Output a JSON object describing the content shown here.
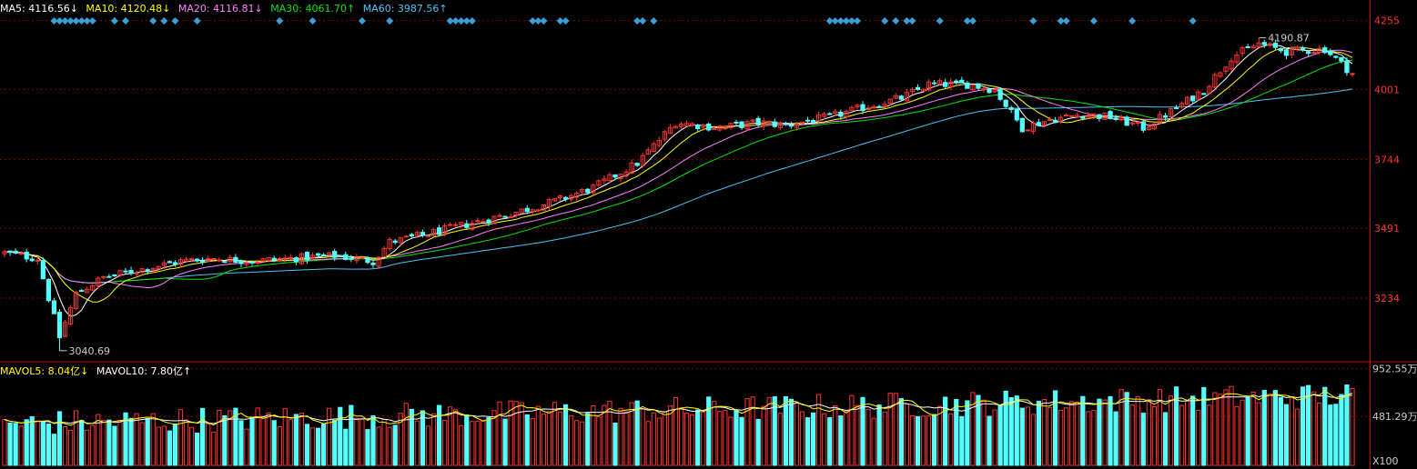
{
  "colors": {
    "up": "#ff3232",
    "down": "#54ffff",
    "grid": "#8b0000",
    "axis_text": "#ff3232",
    "ma5": "#ffffff",
    "ma10": "#ffff00",
    "ma20": "#ff80ff",
    "ma30": "#00e600",
    "ma60": "#4fc3f7",
    "marker": "#3aa0d9"
  },
  "legends": {
    "ma5": "MA5: 4116.56↓",
    "ma10": "MA10: 4120.48↓",
    "ma20": "MA20: 4116.81↓",
    "ma30": "MA30: 4061.70↑",
    "ma60": "MA60: 3987.56↑",
    "mavol5": "MAVOL5: 8.04亿↓",
    "mavol10": "MAVOL10: 7.80亿↑"
  },
  "chart_data": {
    "type": "candlestick",
    "price_axis": {
      "ylim": [
        3000,
        4330
      ],
      "ticks": [
        "4255",
        "4001",
        "3744",
        "3491",
        "3234"
      ],
      "tick_values": [
        4255,
        4001,
        3744,
        3491,
        3234
      ]
    },
    "volume_axis": {
      "ylim": [
        0,
        1000
      ],
      "ticks": [
        "952.55万",
        "481.29万"
      ],
      "tick_values": [
        952.55,
        481.29
      ],
      "unit": "X100"
    },
    "annotations": [
      {
        "text": "4190.87",
        "value": 4190.87,
        "bar": 228
      },
      {
        "text": "3040.69",
        "value": 3040.69,
        "bar": 10
      }
    ],
    "bar_count": 246,
    "anchors": [
      {
        "i": 0,
        "v": 3400
      },
      {
        "i": 6,
        "v": 3380
      },
      {
        "i": 10,
        "v": 3090
      },
      {
        "i": 13,
        "v": 3250
      },
      {
        "i": 18,
        "v": 3310
      },
      {
        "i": 25,
        "v": 3340
      },
      {
        "i": 32,
        "v": 3370
      },
      {
        "i": 38,
        "v": 3380
      },
      {
        "i": 45,
        "v": 3370
      },
      {
        "i": 52,
        "v": 3380
      },
      {
        "i": 60,
        "v": 3390
      },
      {
        "i": 67,
        "v": 3370
      },
      {
        "i": 70,
        "v": 3440
      },
      {
        "i": 77,
        "v": 3470
      },
      {
        "i": 85,
        "v": 3510
      },
      {
        "i": 93,
        "v": 3550
      },
      {
        "i": 100,
        "v": 3590
      },
      {
        "i": 107,
        "v": 3640
      },
      {
        "i": 115,
        "v": 3730
      },
      {
        "i": 122,
        "v": 3880
      },
      {
        "i": 130,
        "v": 3860
      },
      {
        "i": 137,
        "v": 3880
      },
      {
        "i": 142,
        "v": 3870
      },
      {
        "i": 150,
        "v": 3900
      },
      {
        "i": 157,
        "v": 3940
      },
      {
        "i": 163,
        "v": 3970
      },
      {
        "i": 168,
        "v": 4020
      },
      {
        "i": 175,
        "v": 4020
      },
      {
        "i": 180,
        "v": 4000
      },
      {
        "i": 185,
        "v": 3860
      },
      {
        "i": 190,
        "v": 3890
      },
      {
        "i": 196,
        "v": 3910
      },
      {
        "i": 201,
        "v": 3900
      },
      {
        "i": 207,
        "v": 3860
      },
      {
        "i": 212,
        "v": 3920
      },
      {
        "i": 218,
        "v": 4000
      },
      {
        "i": 223,
        "v": 4120
      },
      {
        "i": 228,
        "v": 4170
      },
      {
        "i": 233,
        "v": 4140
      },
      {
        "i": 240,
        "v": 4150
      },
      {
        "i": 245,
        "v": 4060
      }
    ],
    "ma_end_values": {
      "ma5": 4116.56,
      "ma10": 4120.48,
      "ma20": 4116.81,
      "ma30": 4061.7,
      "ma60": 3987.56
    },
    "marker_bars": [
      9,
      10,
      11,
      12,
      13,
      14,
      15,
      16,
      20,
      22,
      27,
      29,
      31,
      35,
      50,
      56,
      65,
      70,
      81,
      82,
      83,
      84,
      85,
      96,
      97,
      98,
      101,
      102,
      115,
      116,
      118,
      150,
      151,
      152,
      153,
      154,
      155,
      160,
      162,
      164,
      165,
      170,
      175,
      176,
      187,
      192,
      193,
      198,
      205,
      216
    ]
  }
}
